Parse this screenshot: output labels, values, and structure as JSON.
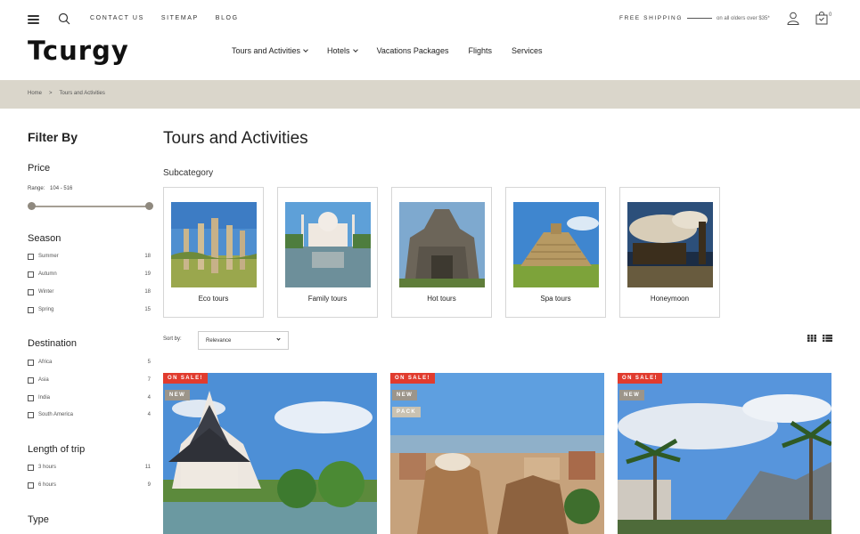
{
  "header": {
    "top_links": [
      "CONTACT US",
      "SITEMAP",
      "BLOG"
    ],
    "shipping_title": "FREE SHIPPING",
    "shipping_sub": "on all olders over $35*",
    "cart_count": "0",
    "logo": "Tcurgy"
  },
  "nav": {
    "items": [
      {
        "label": "Tours and Activities",
        "dropdown": true
      },
      {
        "label": "Hotels",
        "dropdown": true
      },
      {
        "label": "Vacations Packages",
        "dropdown": false
      },
      {
        "label": "Flights",
        "dropdown": false
      },
      {
        "label": "Services",
        "dropdown": false
      }
    ]
  },
  "breadcrumb": {
    "home": "Home",
    "sep": ">",
    "current": "Tours and Activities"
  },
  "sidebar": {
    "title": "Filter By",
    "price": {
      "title": "Price",
      "range_label": "Range:",
      "range_value": "104 - 516"
    },
    "season": {
      "title": "Season",
      "options": [
        {
          "label": "Summer",
          "count": "18"
        },
        {
          "label": "Autumn",
          "count": "19"
        },
        {
          "label": "Winter",
          "count": "18"
        },
        {
          "label": "Spring",
          "count": "15"
        }
      ]
    },
    "destination": {
      "title": "Destination",
      "options": [
        {
          "label": "Africa",
          "count": "5"
        },
        {
          "label": "Asia",
          "count": "7"
        },
        {
          "label": "India",
          "count": "4"
        },
        {
          "label": "South America",
          "count": "4"
        }
      ]
    },
    "length": {
      "title": "Length of trip",
      "options": [
        {
          "label": "3 hours",
          "count": "11"
        },
        {
          "label": "6 hours",
          "count": "9"
        }
      ]
    },
    "type": {
      "title": "Type"
    }
  },
  "main": {
    "title": "Tours and Activities",
    "subcategory_title": "Subcategory",
    "subcategories": [
      "Eco tours",
      "Family tours",
      "Hot tours",
      "Spa tours",
      "Honeymoon"
    ],
    "sort_label": "Sort by:",
    "sort_value": "Relevance"
  },
  "products": [
    {
      "badges": [
        "ON SALE!",
        "NEW"
      ]
    },
    {
      "badges": [
        "ON SALE!",
        "NEW",
        "PACK"
      ]
    },
    {
      "badges": [
        "ON SALE!",
        "NEW"
      ]
    }
  ],
  "colors": {
    "band": "#dad6cb",
    "sale": "#e13b2e",
    "new": "#9c958a",
    "pack": "#c9c2b2"
  }
}
